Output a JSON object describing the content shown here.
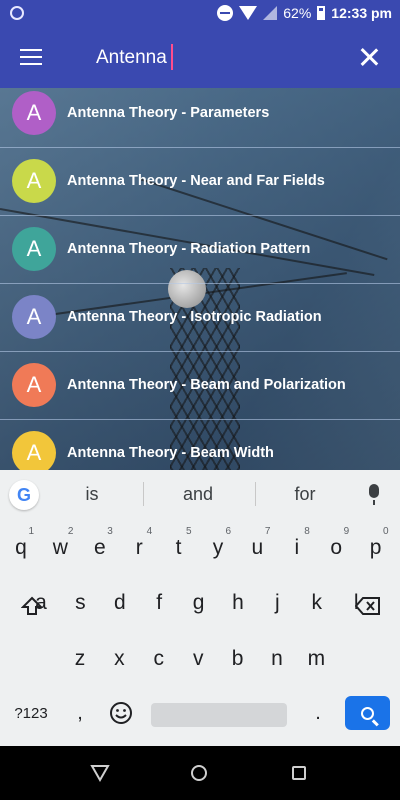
{
  "status_bar": {
    "battery": "62%",
    "time": "12:33 pm",
    "icons": [
      "circle-icon",
      "do-not-disturb-icon",
      "wifi-icon",
      "signal-icon",
      "battery-icon"
    ]
  },
  "app_bar": {
    "search_value": "Antenna",
    "icons": [
      "menu-icon",
      "close-icon"
    ],
    "color": "#3a49b0"
  },
  "results": [
    {
      "letter": "A",
      "label": "Antenna Theory - Parameters",
      "color": "#b05fc7"
    },
    {
      "letter": "A",
      "label": "Antenna Theory - Near and Far Fields",
      "color": "#c9d94a"
    },
    {
      "letter": "A",
      "label": "Antenna Theory - Radiation Pattern",
      "color": "#3fa59a"
    },
    {
      "letter": "A",
      "label": "Antenna Theory - Isotropic Radiation",
      "color": "#7b84c7"
    },
    {
      "letter": "A",
      "label": "Antenna Theory - Beam and Polarization",
      "color": "#f07a57"
    },
    {
      "letter": "A",
      "label": "Antenna Theory - Beam Width",
      "color": "#f2c63a"
    }
  ],
  "keyboard": {
    "suggestions": [
      "is",
      "and",
      "for"
    ],
    "row1": [
      {
        "k": "q",
        "n": "1"
      },
      {
        "k": "w",
        "n": "2"
      },
      {
        "k": "e",
        "n": "3"
      },
      {
        "k": "r",
        "n": "4"
      },
      {
        "k": "t",
        "n": "5"
      },
      {
        "k": "y",
        "n": "6"
      },
      {
        "k": "u",
        "n": "7"
      },
      {
        "k": "i",
        "n": "8"
      },
      {
        "k": "o",
        "n": "9"
      },
      {
        "k": "p",
        "n": "0"
      }
    ],
    "row2": [
      "a",
      "s",
      "d",
      "f",
      "g",
      "h",
      "j",
      "k",
      "l"
    ],
    "row3": [
      "z",
      "x",
      "c",
      "v",
      "b",
      "n",
      "m"
    ],
    "symbols_key": "?123",
    "comma_key": ",",
    "period_key": ".",
    "icons": [
      "google-icon",
      "mic-icon",
      "shift-icon",
      "backspace-icon",
      "emoji-icon",
      "search-icon"
    ]
  },
  "nav_bar": {
    "icons": [
      "back-icon",
      "home-icon",
      "recents-icon"
    ]
  }
}
